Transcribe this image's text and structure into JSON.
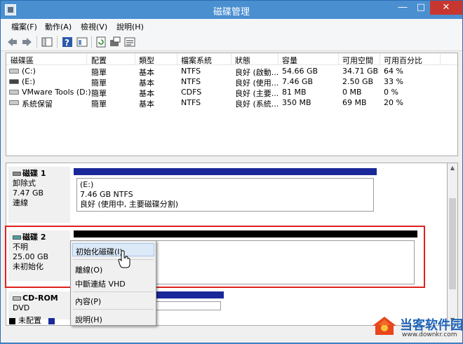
{
  "window": {
    "title": "磁碟管理"
  },
  "menu": [
    "檔案(F)",
    "動作(A)",
    "檢視(V)",
    "說明(H)"
  ],
  "columns": [
    "磁碟區",
    "配置",
    "類型",
    "檔案系統",
    "狀態",
    "容量",
    "可用空間",
    "可用百分比"
  ],
  "volumes": [
    [
      "(C:)",
      "簡單",
      "基本",
      "NTFS",
      "良好 (啟動...",
      "54.66 GB",
      "34.71 GB",
      "64 %"
    ],
    [
      "(E:)",
      "簡單",
      "基本",
      "NTFS",
      "良好 (使用...",
      "7.46 GB",
      "2.50 GB",
      "33 %"
    ],
    [
      "VMware Tools (D:)",
      "簡單",
      "基本",
      "CDFS",
      "良好 (主要...",
      "81 MB",
      "0 MB",
      "0 %"
    ],
    [
      "系統保留",
      "簡單",
      "基本",
      "NTFS",
      "良好 (系統...",
      "350 MB",
      "69 MB",
      "20 %"
    ]
  ],
  "disks": {
    "disk1": {
      "name": "磁碟 1",
      "type": "卸除式",
      "size": "7.47 GB",
      "status": "連線",
      "volume": {
        "label": "(E:)",
        "size_fs": "7.46 GB NTFS",
        "status": "良好 (使用中, 主要磁碟分割)"
      }
    },
    "disk2": {
      "name": "磁碟 2",
      "type": "不明",
      "size": "25.00 GB",
      "status": "未初始化"
    },
    "cdrom": {
      "name": "CD-ROM",
      "type": "DVD"
    }
  },
  "context_menu": [
    "初始化磁碟(I)",
    "離線(O)",
    "中斷連結 VHD",
    "內容(P)",
    "說明(H)"
  ],
  "legend": {
    "unallocated": "未配置"
  },
  "watermark": {
    "text": "当客软件园",
    "url": "www.downkr.com"
  },
  "colors": {
    "primary_partition": "#1a2899",
    "unallocated": "#000000",
    "highlight": "#e02020"
  }
}
